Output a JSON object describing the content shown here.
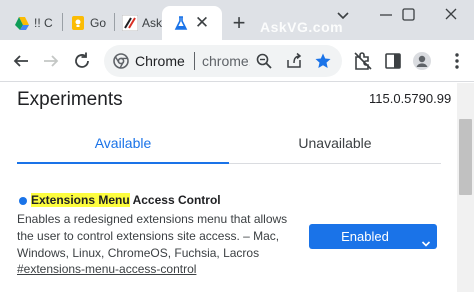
{
  "tabs": [
    {
      "title": "!! C",
      "favicon": "google-drive-icon"
    },
    {
      "title": "Go",
      "favicon": "google-keep-icon"
    },
    {
      "title": "Ask",
      "favicon": "askvg-icon"
    },
    {
      "title": "",
      "favicon": "chrome-flask-icon",
      "active": true
    }
  ],
  "watermark": "AskVG.com",
  "omnibox": {
    "site_label": "Chrome",
    "url": "chrome://flags"
  },
  "page": {
    "title": "Experiments",
    "version": "115.0.5790.99",
    "tab_available": "Available",
    "tab_unavailable": "Unavailable"
  },
  "experiment": {
    "title_highlight": "Extensions Menu",
    "title_rest": " Access Control",
    "description": "Enables a redesigned extensions menu that allows the user to control extensions site access. – Mac, Windows, Linux, ChromeOS, Fuchsia, Lacros",
    "link": "#extensions-menu-access-control",
    "state": "Enabled"
  },
  "colors": {
    "accent": "#1a73e8",
    "highlight": "#fdfd3f",
    "tabstrip": "#dee1e6"
  }
}
